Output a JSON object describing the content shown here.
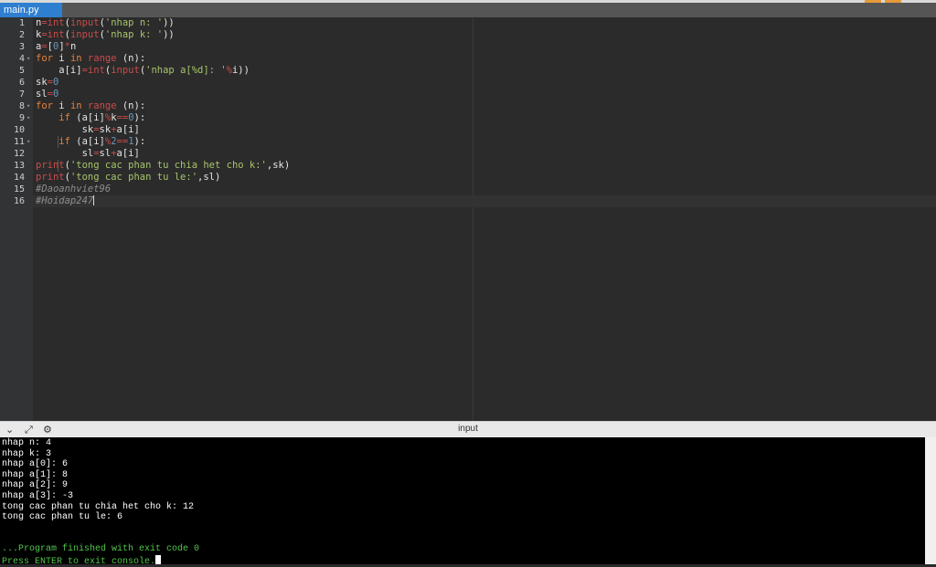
{
  "tab": {
    "name": "main.py"
  },
  "gutter": {
    "lines": [
      "1",
      "2",
      "3",
      "4",
      "5",
      "6",
      "7",
      "8",
      "9",
      "10",
      "11",
      "12",
      "13",
      "14",
      "15",
      "16"
    ]
  },
  "code_tokens": [
    [
      [
        "n",
        ""
      ],
      [
        "=",
        "op"
      ],
      [
        "int",
        "bi"
      ],
      [
        "(",
        ""
      ],
      [
        "input",
        "bi"
      ],
      [
        "(",
        ""
      ],
      [
        "'nhap n: '",
        "str"
      ],
      [
        "))",
        ""
      ]
    ],
    [
      [
        "k",
        ""
      ],
      [
        "=",
        "op"
      ],
      [
        "int",
        "bi"
      ],
      [
        "(",
        ""
      ],
      [
        "input",
        "bi"
      ],
      [
        "(",
        ""
      ],
      [
        "'nhap k: '",
        "str"
      ],
      [
        "))",
        ""
      ]
    ],
    [
      [
        "a",
        ""
      ],
      [
        "=",
        "op"
      ],
      [
        "[",
        ""
      ],
      [
        "0",
        "num"
      ],
      [
        "]",
        ""
      ],
      [
        "*",
        "op"
      ],
      [
        "n",
        ""
      ]
    ],
    [
      [
        "for",
        "kw"
      ],
      [
        " i ",
        ""
      ],
      [
        "in",
        "kw"
      ],
      [
        " ",
        ""
      ],
      [
        "range",
        "bi"
      ],
      [
        " (n):",
        ""
      ]
    ],
    [
      [
        "    a[i]",
        ""
      ],
      [
        "=",
        "op"
      ],
      [
        "int",
        "bi"
      ],
      [
        "(",
        ""
      ],
      [
        "input",
        "bi"
      ],
      [
        "(",
        ""
      ],
      [
        "'nhap a[%d]: '",
        "str"
      ],
      [
        "%",
        "op"
      ],
      [
        "i))",
        ""
      ]
    ],
    [
      [
        "sk",
        ""
      ],
      [
        "=",
        "op"
      ],
      [
        "0",
        "num"
      ]
    ],
    [
      [
        "sl",
        ""
      ],
      [
        "=",
        "op"
      ],
      [
        "0",
        "num"
      ]
    ],
    [
      [
        "for",
        "kw"
      ],
      [
        " i ",
        ""
      ],
      [
        "in",
        "kw"
      ],
      [
        " ",
        ""
      ],
      [
        "range",
        "bi"
      ],
      [
        " (n):",
        ""
      ]
    ],
    [
      [
        "    ",
        ""
      ],
      [
        "if",
        "kw"
      ],
      [
        " (a[i]",
        ""
      ],
      [
        "%",
        "op"
      ],
      [
        "k",
        ""
      ],
      [
        "==",
        "op"
      ],
      [
        "0",
        "num"
      ],
      [
        "):",
        ""
      ]
    ],
    [
      [
        "        sk",
        ""
      ],
      [
        "=",
        "op"
      ],
      [
        "sk",
        ""
      ],
      [
        "+",
        "op"
      ],
      [
        "a[i]",
        ""
      ]
    ],
    [
      [
        "    ",
        ""
      ],
      [
        "if",
        "kw"
      ],
      [
        " (a[i]",
        ""
      ],
      [
        "%",
        "op"
      ],
      [
        "2",
        "num"
      ],
      [
        "==",
        "op"
      ],
      [
        "1",
        "num"
      ],
      [
        "):",
        ""
      ]
    ],
    [
      [
        "        sl",
        ""
      ],
      [
        "=",
        "op"
      ],
      [
        "sl",
        ""
      ],
      [
        "+",
        "op"
      ],
      [
        "a[i]",
        ""
      ]
    ],
    [
      [
        "print",
        "bi"
      ],
      [
        "(",
        ""
      ],
      [
        "'tong cac phan tu chia het cho k:'",
        "str"
      ],
      [
        ",sk)",
        ""
      ]
    ],
    [
      [
        "print",
        "bi"
      ],
      [
        "(",
        ""
      ],
      [
        "'tong cac phan tu le:'",
        "str"
      ],
      [
        ",sl)",
        ""
      ]
    ],
    [
      [
        "#Daoanhviet96",
        "cm"
      ]
    ],
    [
      [
        "#Hoidap247",
        "cm"
      ]
    ]
  ],
  "fold_lines": [
    4,
    8,
    9,
    11
  ],
  "panel": {
    "title": "input"
  },
  "console_lines": [
    "nhap n: 4",
    "nhap k: 3",
    "nhap a[0]: 6",
    "nhap a[1]: 8",
    "nhap a[2]: 9",
    "nhap a[3]: -3",
    "tong cac phan tu chia het cho k: 12",
    "tong cac phan tu le: 6",
    "",
    "",
    "...Program finished with exit code 0",
    "Press ENTER to exit console."
  ],
  "colors": {
    "keyword": "#e8813a",
    "builtin": "#cc4a4a",
    "string": "#a6c46a",
    "number": "#6897bb",
    "comment": "#8e8e8e",
    "console_green": "#53c64b",
    "tab_active": "#2f7fd0"
  },
  "icons": [
    "chevron-down-icon",
    "expand-icon",
    "settings-icon"
  ]
}
